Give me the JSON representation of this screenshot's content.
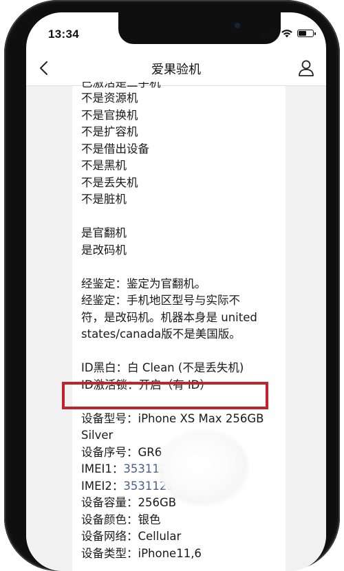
{
  "status_bar": {
    "time": "13:34",
    "battery_level": 0.6
  },
  "nav": {
    "title": "爱果验机"
  },
  "message": {
    "partial_top": "已激活是二手机",
    "lines_group1": [
      "不是资源机",
      "不是官换机",
      "不是扩容机",
      "不是借出设备",
      "不是黑机",
      "不是丢失机",
      "不是脏机"
    ],
    "lines_group2": [
      "是官翻机",
      "是改码机"
    ],
    "appraisal": [
      "经鉴定：鉴定为官翻机。",
      "经鉴定：手机地区型号与实际不",
      "符，是改码机。机器本身是 united",
      "states/canada版不是美国版。"
    ],
    "id_blacklist": "ID黑白：白 Clean (不是丢失机)",
    "id_lock": "ID激活锁：开启（有 ID）",
    "device": {
      "model_line1": "设备型号：iPhone XS Max 256GB",
      "model_line2": "Silver",
      "serial_label": "设备序号：",
      "serial_value": "GR6",
      "imei1_label": "IMEI1：",
      "imei1_value": "3531121",
      "imei2_label": "IMEI2：",
      "imei2_value": "3531121",
      "capacity": "设备容量：256GB",
      "color": "设备颜色：银色",
      "network": "设备网络：Cellular",
      "type": "设备类型：iPhone11,6"
    }
  },
  "colors": {
    "highlight_border": "#c0232c",
    "imei_text": "#4a5f8c",
    "chat_bg": "#f1f1f1"
  }
}
